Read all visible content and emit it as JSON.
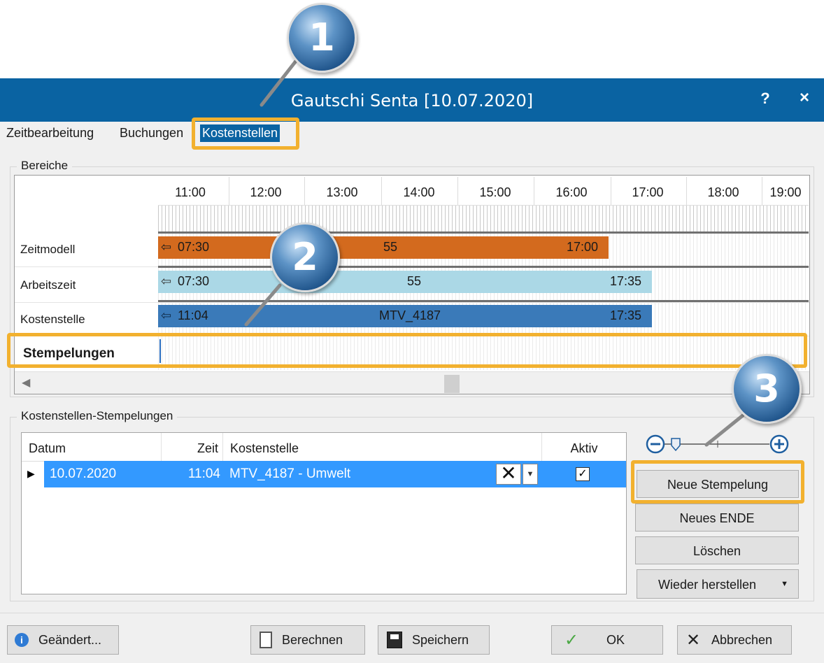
{
  "window": {
    "title": "Gautschi Senta [10.07.2020]",
    "help_label": "?",
    "close_label": "×",
    "accent_color": "#0a63a2",
    "highlight_color": "#f2b12f"
  },
  "tabs": [
    {
      "label": "Zeitbearbeitung"
    },
    {
      "label": "Buchungen"
    },
    {
      "label": "Kostenstellen",
      "active": true
    }
  ],
  "bereiche": {
    "label": "Bereiche",
    "hours": [
      "11:00",
      "12:00",
      "13:00",
      "14:00",
      "15:00",
      "16:00",
      "17:00",
      "18:00",
      "19:00"
    ],
    "rows": {
      "zeitmodell": {
        "label": "Zeitmodell",
        "start": "07:30",
        "middle": "55",
        "end": "17:00",
        "color": "#d36a1e"
      },
      "arbeitszeit": {
        "label": "Arbeitszeit",
        "start": "07:30",
        "middle": "55",
        "end": "17:35",
        "color": "#abd8e6"
      },
      "kostenstelle": {
        "label": "Kostenstelle",
        "start": "11:04",
        "middle": "MTV_4187",
        "end": "17:35",
        "color": "#3a7ab9"
      },
      "stempelungen": {
        "label": "Stempelungen"
      }
    }
  },
  "kst_stempelungen": {
    "label": "Kostenstellen-Stempelungen",
    "columns": {
      "datum": "Datum",
      "zeit": "Zeit",
      "kostenstelle": "Kostenstelle",
      "aktiv": "Aktiv"
    },
    "rows": [
      {
        "datum": "10.07.2020",
        "zeit": "11:04",
        "kostenstelle": "MTV_4187 - Umwelt",
        "aktiv": true
      }
    ],
    "selection_color": "#3399ff"
  },
  "side_buttons": {
    "neue_stempelung": "Neue Stempelung",
    "neues_ende": "Neues ENDE",
    "loeschen": "Löschen",
    "wieder_herstellen": "Wieder herstellen"
  },
  "footer": {
    "geaendert": "Geändert...",
    "berechnen": "Berechnen",
    "speichern": "Speichern",
    "ok": "OK",
    "abbrechen": "Abbrechen"
  },
  "callouts": [
    "1",
    "2",
    "3"
  ]
}
